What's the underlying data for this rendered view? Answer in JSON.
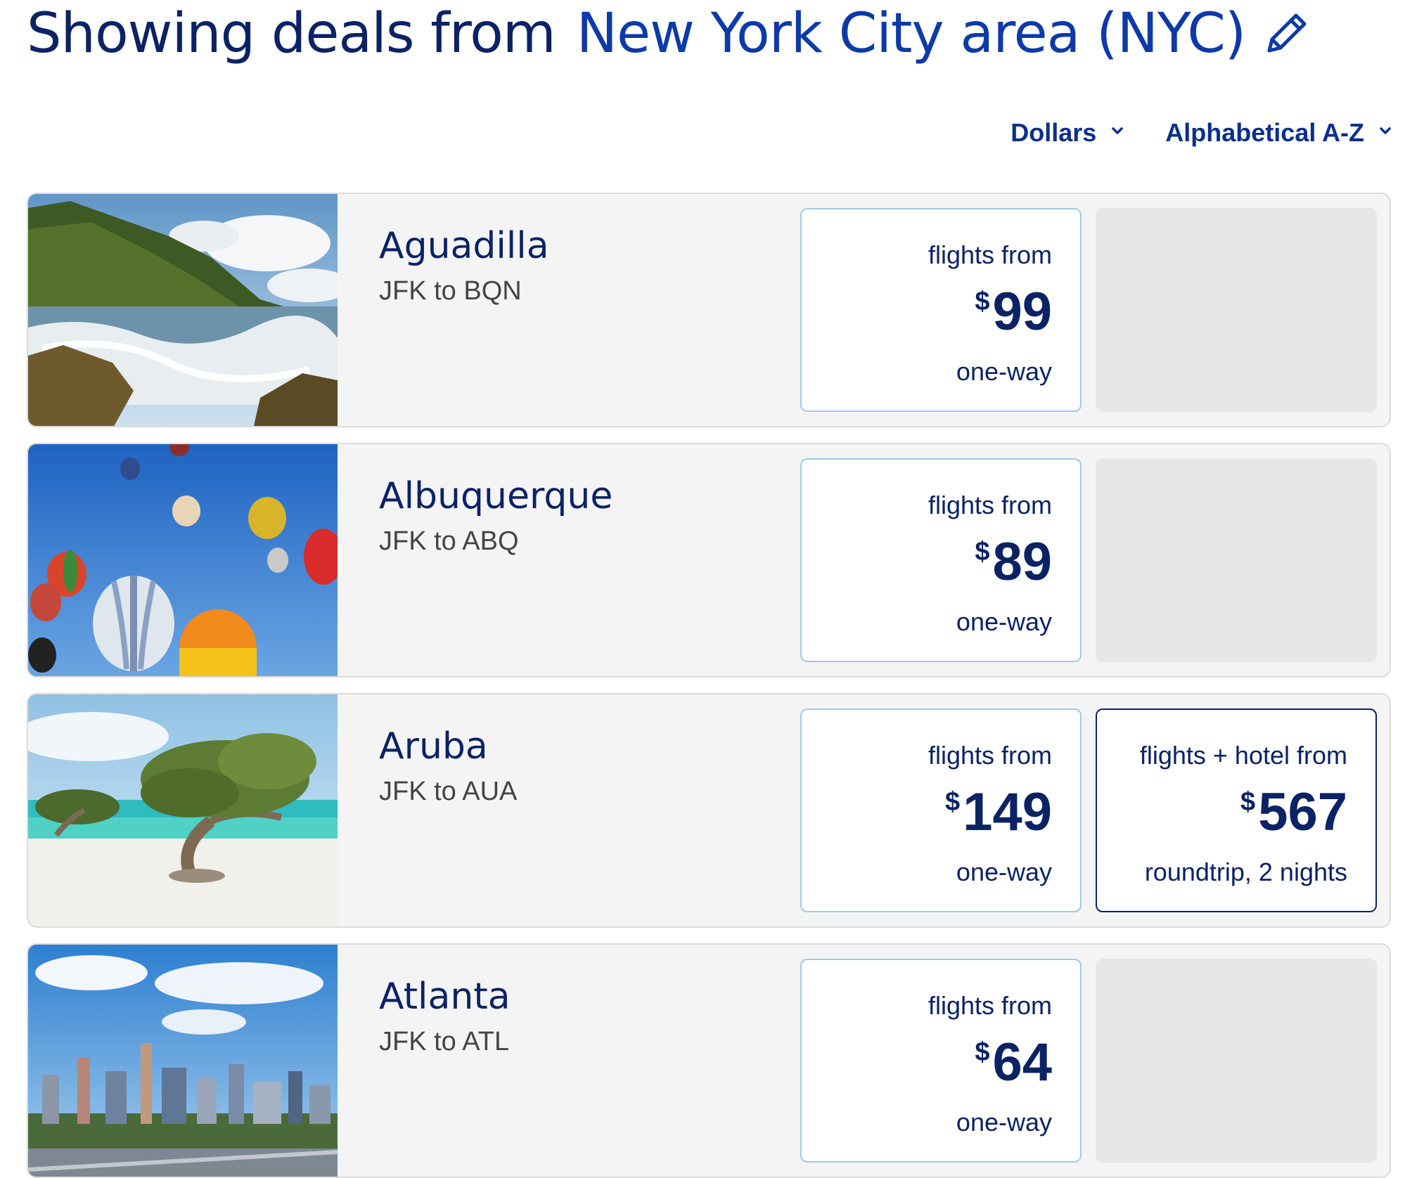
{
  "header": {
    "lead": "Showing deals from",
    "city": "New York City area (NYC)",
    "edit_icon": "pencil-icon"
  },
  "controls": {
    "currency": "Dollars",
    "sort": "Alphabetical A-Z",
    "chevron_icon": "chevron-down-icon"
  },
  "deals": [
    {
      "name": "Aguadilla",
      "route": "JFK to BQN",
      "image": "coastal-waves-photo",
      "flights": {
        "label": "flights from",
        "currency": "$",
        "price": "99",
        "note": "one-way"
      }
    },
    {
      "name": "Albuquerque",
      "route": "JFK to ABQ",
      "image": "hot-air-balloons-photo",
      "flights": {
        "label": "flights from",
        "currency": "$",
        "price": "89",
        "note": "one-way"
      }
    },
    {
      "name": "Aruba",
      "route": "JFK to AUA",
      "image": "divi-tree-beach-photo",
      "flights": {
        "label": "flights from",
        "currency": "$",
        "price": "149",
        "note": "one-way"
      },
      "hotel": {
        "label": "flights + hotel from",
        "currency": "$",
        "price": "567",
        "note": "roundtrip, 2 nights"
      }
    },
    {
      "name": "Atlanta",
      "route": "JFK to ATL",
      "image": "city-skyline-photo",
      "flights": {
        "label": "flights from",
        "currency": "$",
        "price": "64",
        "note": "one-way"
      }
    }
  ],
  "colors": {
    "navy": "#0b2265",
    "link_blue": "#0d3aa8",
    "card_bg": "#f4f4f4",
    "flight_border": "#9fcbe6",
    "placeholder": "#e7e7e7"
  }
}
